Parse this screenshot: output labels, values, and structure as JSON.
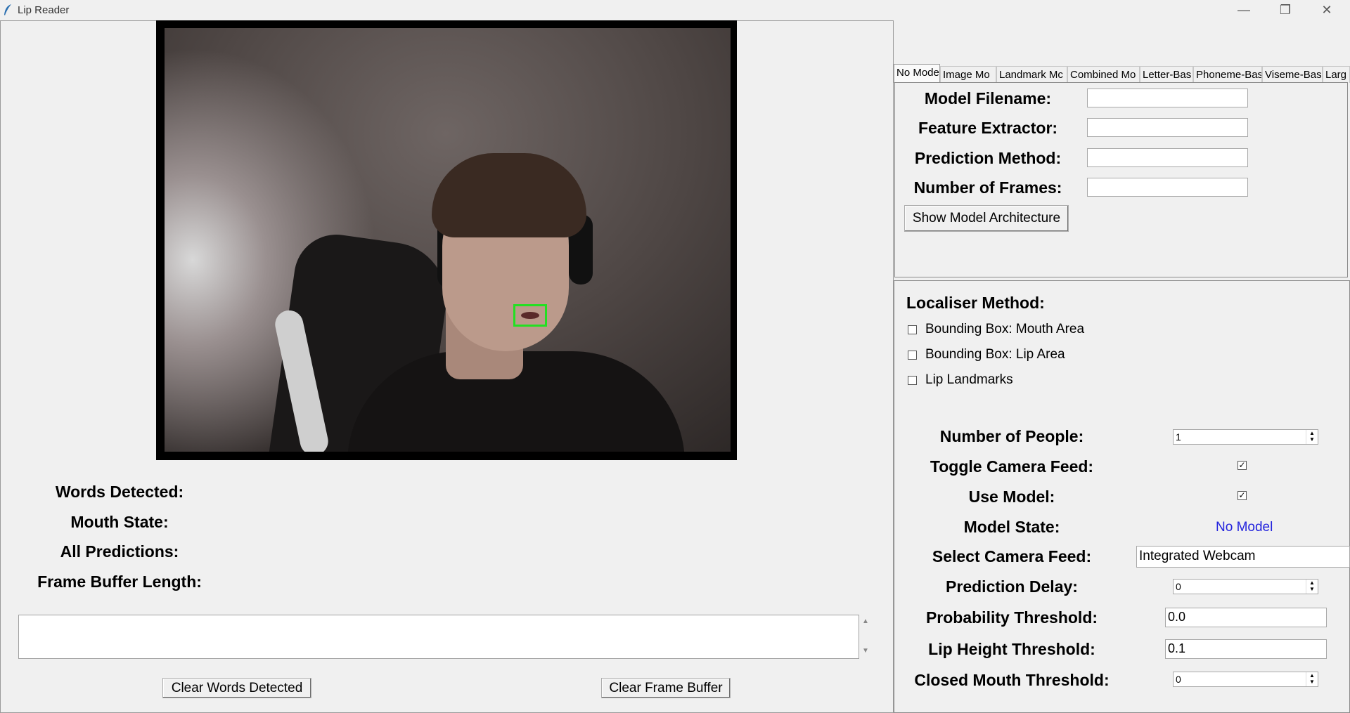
{
  "window": {
    "title": "Lip Reader"
  },
  "video": {
    "feed": "webcam"
  },
  "info": {
    "words_detected": "Words Detected:",
    "mouth_state": "Mouth State:",
    "all_predictions": "All Predictions:",
    "frame_buffer_length": "Frame Buffer Length:"
  },
  "buttons": {
    "clear_words": "Clear Words Detected",
    "clear_buffer": "Clear Frame Buffer",
    "show_arch": "Show Model Architecture"
  },
  "tabs": [
    {
      "label": "No Mode"
    },
    {
      "label": "Image Mo"
    },
    {
      "label": "Landmark Mc"
    },
    {
      "label": "Combined Mo"
    },
    {
      "label": "Letter-Bas"
    },
    {
      "label": "Phoneme-Bas"
    },
    {
      "label": "Viseme-Bas"
    },
    {
      "label": "Larg"
    }
  ],
  "model": {
    "filename_label": "Model Filename:",
    "extractor_label": "Feature Extractor:",
    "prediction_label": "Prediction Method:",
    "frames_label": "Number of Frames:",
    "filename_value": "",
    "extractor_value": "",
    "prediction_value": "",
    "frames_value": ""
  },
  "settings": {
    "localiser_label": "Localiser Method:",
    "options": [
      "Bounding Box: Mouth Area",
      "Bounding Box: Lip Area",
      "Lip Landmarks"
    ],
    "people_label": "Number of People:",
    "people_value": "1",
    "toggle_label": "Toggle Camera Feed:",
    "use_model_label": "Use Model:",
    "model_state_label": "Model State:",
    "model_state_value": "No Model",
    "camera_label": "Select Camera Feed:",
    "camera_value": "Integrated Webcam",
    "delay_label": "Prediction Delay:",
    "delay_value": "0",
    "prob_label": "Probability Threshold:",
    "prob_value": "0.0",
    "lip_label": "Lip Height Threshold:",
    "lip_value": "0.1",
    "closed_label": "Closed Mouth Threshold:",
    "closed_value": "0"
  },
  "colors": {
    "accent_green": "#22e022",
    "status_blue": "#2222dd"
  }
}
